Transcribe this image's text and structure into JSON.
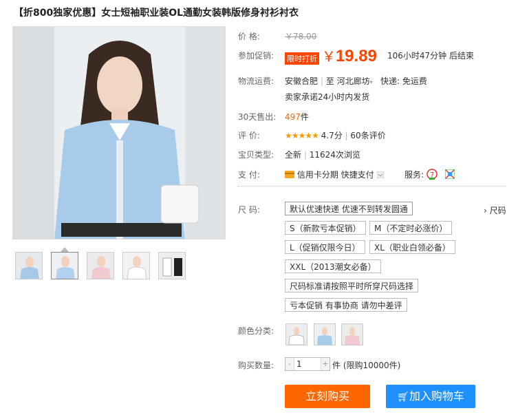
{
  "title": "【折800独家优惠】女士短袖职业装OL通勤女装韩版修身衬衫衬衣",
  "price": {
    "label": "价      格:",
    "original": "￥78.00"
  },
  "promo": {
    "label": "参加促销:",
    "tag": "限时打折",
    "currency": "￥",
    "amount": "19.89",
    "countdown": "106小时47分钟 后结束"
  },
  "shipping": {
    "label": "物流运费:",
    "from": "安徽合肥",
    "sep": "|",
    "to_prefix": "至",
    "to": "河北廊坊",
    "fee": "快递: 免运费",
    "promise": "卖家承诺24小时内发货"
  },
  "sales": {
    "label": "30天售出:",
    "count": "497",
    "unit": "件"
  },
  "rating": {
    "label": "评      价:",
    "stars": "★★★★★",
    "score": "4.7分",
    "sep": "|",
    "reviews": "60条评价"
  },
  "type": {
    "label": "宝贝类型:",
    "condition": "全新",
    "sep": "|",
    "views": "11624次浏览"
  },
  "payment": {
    "label": "支      付:",
    "credit": "信用卡分期",
    "quick": "快捷支付",
    "service_label": "服务:"
  },
  "size": {
    "label": "尺      码:",
    "right_label": "尺码",
    "options": [
      "默认优速快递 优速不到转发圆通",
      "S（新款亏本促销）",
      "M（不定时必涨价）",
      "L（促销仅限今日）",
      "XL（职业白领必备）",
      "XXL（2013潮女必备）",
      "尺码标准请按照平时所穿尺码选择",
      "亏本促销 有事协商 请勿中差评"
    ]
  },
  "color": {
    "label": "颜色分类:"
  },
  "quantity": {
    "label": "购买数量:",
    "minus": "-",
    "plus": "+",
    "value": "1",
    "note": "件 (限购10000件)"
  },
  "buttons": {
    "buy": "立刻购买",
    "cart": "加入购物车"
  },
  "colors": {
    "accent": "#ff4400",
    "buy": "#ff6600",
    "cart": "#1e90ff"
  }
}
